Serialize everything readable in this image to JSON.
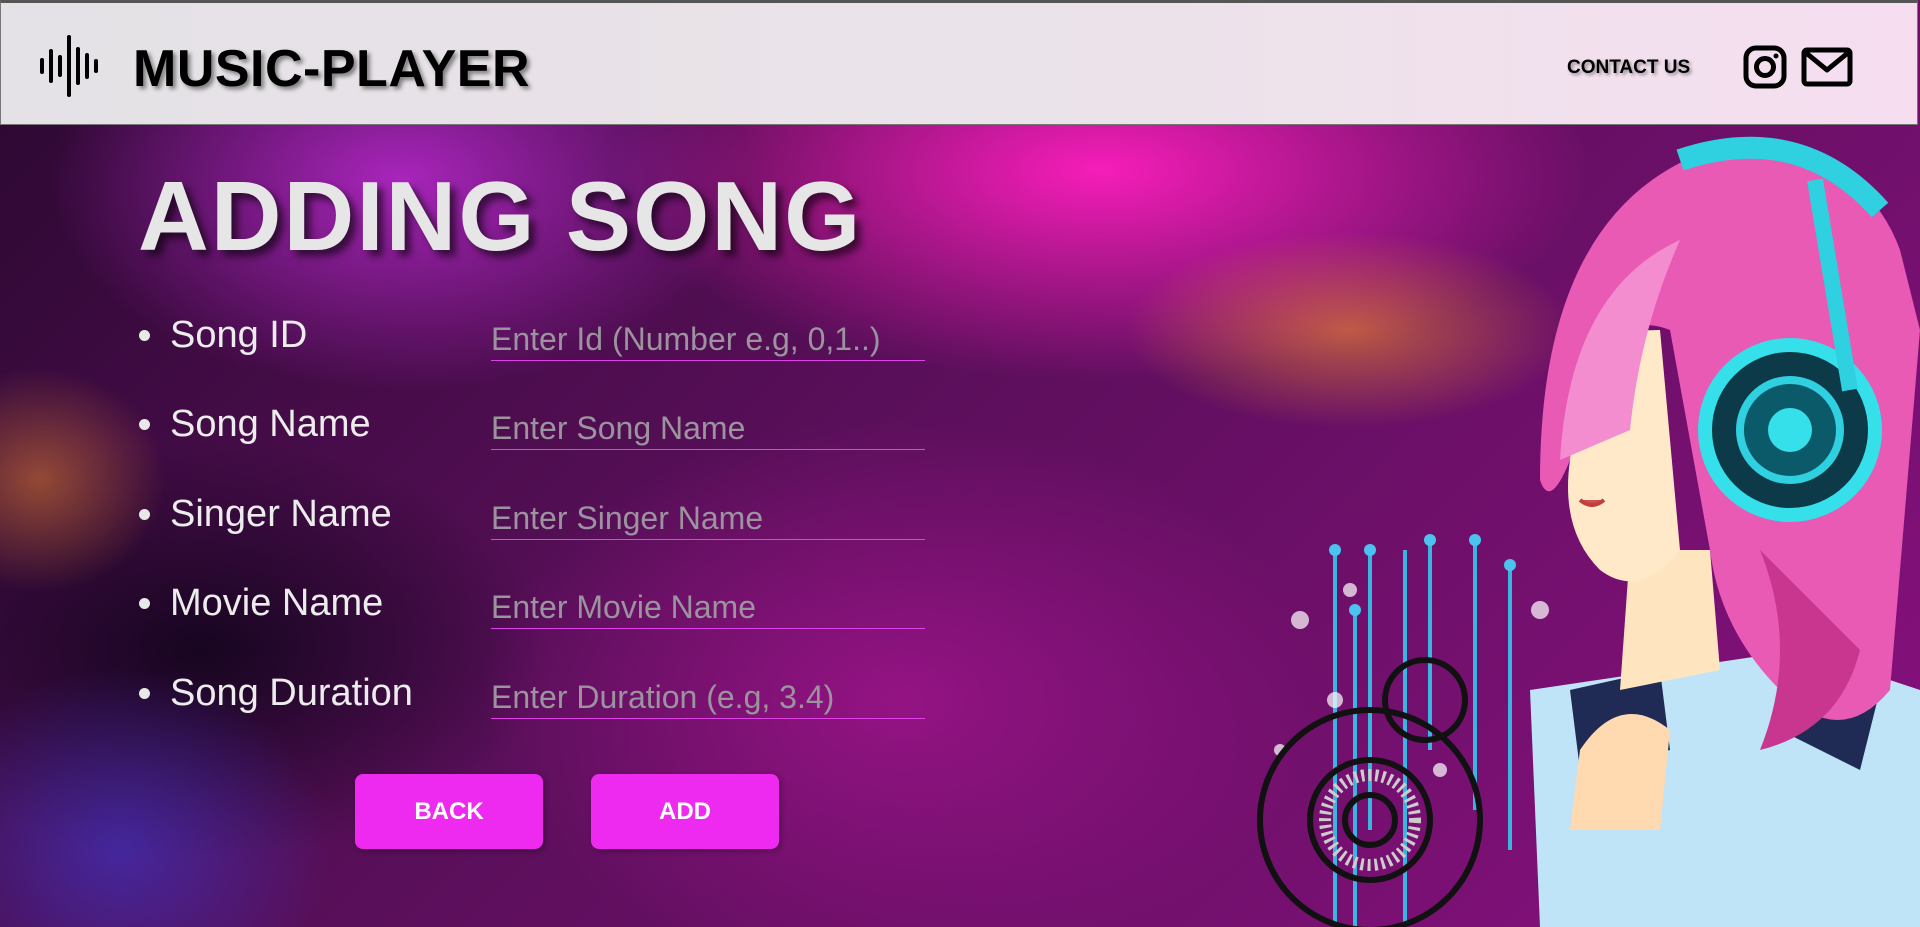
{
  "header": {
    "brand": "MUSIC-PLAYER",
    "contact_label": "CONTACT US",
    "icons": [
      "sound-wave-logo-icon",
      "instagram-icon",
      "mail-icon"
    ]
  },
  "page": {
    "title": "ADDING SONG"
  },
  "form": {
    "fields": [
      {
        "label": "Song ID",
        "placeholder": "Enter Id (Number e.g, 0,1..)",
        "value": ""
      },
      {
        "label": "Song Name",
        "placeholder": "Enter Song Name",
        "value": ""
      },
      {
        "label": "Singer Name",
        "placeholder": "Enter Singer Name",
        "value": ""
      },
      {
        "label": "Movie Name",
        "placeholder": "Enter Movie Name",
        "value": ""
      },
      {
        "label": "Song Duration",
        "placeholder": "Enter Duration (e.g, 3.4)",
        "value": ""
      }
    ]
  },
  "actions": {
    "back_label": "BACK",
    "add_label": "ADD"
  },
  "colors": {
    "accent": "#ee2af0",
    "header_bg": "#e8e4e8",
    "text_light": "#ececec"
  }
}
